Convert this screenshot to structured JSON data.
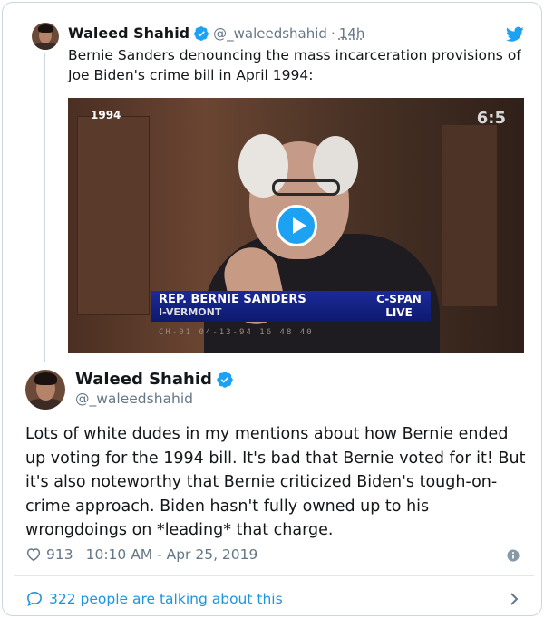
{
  "quoted_tweet": {
    "name": "Waleed Shahid",
    "handle": "@_waleedshahid",
    "separator": "·",
    "time": "14h",
    "text": "Bernie Sanders denouncing the mass incarceration provisions of Joe Biden's crime bill in April 1994:",
    "video": {
      "year_label": "1994",
      "channel_label": "6:5",
      "name_caption": "REP. BERNIE SANDERS",
      "state_caption": "I-VERMONT",
      "network_line1": "C-SPAN",
      "network_line2": "LIVE",
      "date_strip": "CH-01   04-13-94   16 48 40"
    }
  },
  "main_tweet": {
    "name": "Waleed Shahid",
    "handle": "@_waleedshahid",
    "text": "Lots of white dudes in my mentions about how Bernie ended up voting for the 1994 bill. It's bad that Bernie voted for it! But it's also noteworthy that Bernie criticized Biden's tough-on-crime approach. Biden hasn't fully owned up to his wrongdoings on *leading* that charge.",
    "likes": "913",
    "timestamp": "10:10 AM - Apr 25, 2019"
  },
  "footer": {
    "talking_label": "322 people are talking about this"
  },
  "colors": {
    "accent": "#1da1f2",
    "link": "#1b95e0",
    "secondary_text": "#657786",
    "border": "#ccd6dd"
  },
  "icons": [
    "verified-badge-icon",
    "twitter-bird-icon",
    "play-icon",
    "heart-icon",
    "info-icon",
    "speech-bubble-icon",
    "chevron-right-icon"
  ]
}
